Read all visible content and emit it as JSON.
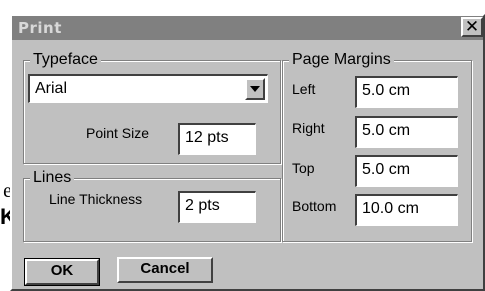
{
  "background": {
    "frag_e": "e",
    "frag_k": "K"
  },
  "dialog": {
    "title": "Print",
    "close_glyph": "✕"
  },
  "typeface": {
    "legend": "Typeface",
    "font_value": "Arial",
    "point_size_label": "Point Size",
    "point_size_value": "12 pts"
  },
  "lines": {
    "legend": "Lines",
    "thickness_label": "Line Thickness",
    "thickness_value": "2 pts"
  },
  "margins": {
    "legend": "Page Margins",
    "left_label": "Left",
    "left_value": "5.0 cm",
    "right_label": "Right",
    "right_value": "5.0 cm",
    "top_label": "Top",
    "top_value": "5.0 cm",
    "bottom_label": "Bottom",
    "bottom_value": "10.0 cm"
  },
  "buttons": {
    "ok": "OK",
    "cancel": "Cancel"
  },
  "colors": {
    "dialog_face": "#c0c0c0",
    "titlebar": "#808080",
    "title_text": "#d8d8d8"
  }
}
